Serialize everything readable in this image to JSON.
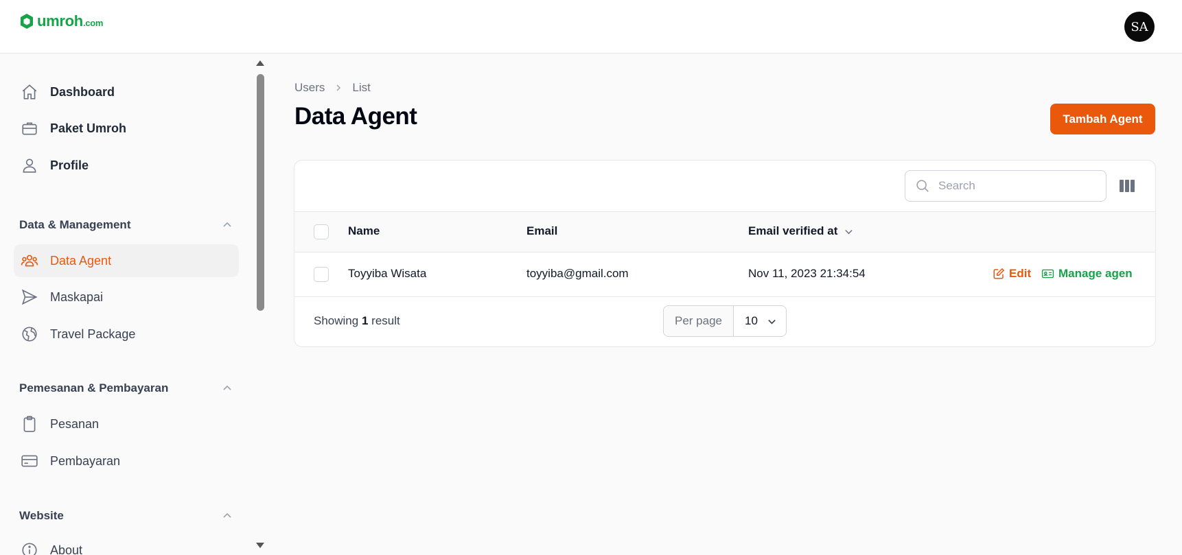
{
  "brand": {
    "name": "umroh",
    "suffix": ".com",
    "color": "#16a34a"
  },
  "user": {
    "initials": "SA"
  },
  "sidebar": {
    "main_items": [
      {
        "label": "Dashboard",
        "icon": "home-icon"
      },
      {
        "label": "Paket Umroh",
        "icon": "briefcase-icon"
      },
      {
        "label": "Profile",
        "icon": "user-icon"
      }
    ],
    "groups": [
      {
        "title": "Data & Management",
        "items": [
          {
            "label": "Data Agent",
            "icon": "users-icon",
            "active": true
          },
          {
            "label": "Maskapai",
            "icon": "paper-plane-icon"
          },
          {
            "label": "Travel Package",
            "icon": "globe-icon"
          }
        ]
      },
      {
        "title": "Pemesanan & Pembayaran",
        "items": [
          {
            "label": "Pesanan",
            "icon": "clipboard-icon"
          },
          {
            "label": "Pembayaran",
            "icon": "credit-card-icon"
          }
        ]
      },
      {
        "title": "Website",
        "items": [
          {
            "label": "About",
            "icon": "info-icon"
          }
        ]
      }
    ]
  },
  "breadcrumb": {
    "parent": "Users",
    "current": "List"
  },
  "page": {
    "title": "Data Agent",
    "add_button": "Tambah Agent",
    "accent": "#ea580c"
  },
  "table": {
    "search_placeholder": "Search",
    "columns": {
      "name": "Name",
      "email": "Email",
      "verified": "Email verified at"
    },
    "rows": [
      {
        "name": "Toyyiba Wisata",
        "email": "toyyiba@gmail.com",
        "verified": "Nov 11, 2023 21:34:54",
        "edit_label": "Edit",
        "manage_label": "Manage agen"
      }
    ],
    "footer": {
      "showing_prefix": "Showing",
      "count": "1",
      "showing_suffix": "result",
      "per_page_label": "Per page",
      "per_page_value": "10"
    }
  }
}
